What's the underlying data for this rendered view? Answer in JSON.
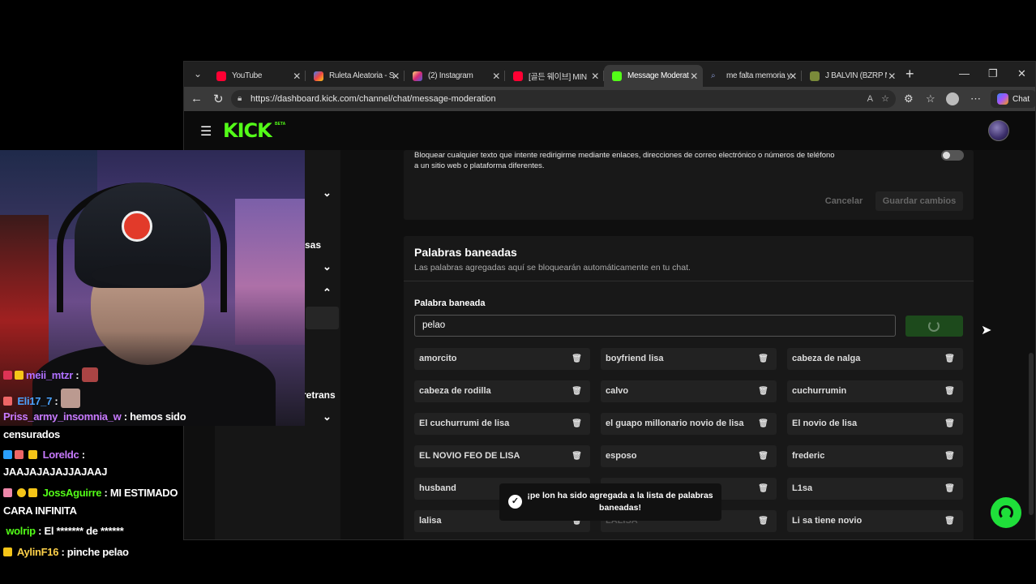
{
  "browser": {
    "tabs": [
      {
        "title": "YouTube",
        "color": "#ff0033"
      },
      {
        "title": "Ruleta Aleatoria - S",
        "color": "#3b82f6"
      },
      {
        "title": "(2) Instagram",
        "color": "#d62976"
      },
      {
        "title": "[골든 웨이브] MIN",
        "color": "#ff0033"
      },
      {
        "title": "Message Moderatio",
        "color": "#53fc18"
      },
      {
        "title": "me falta memoria y",
        "color": "#8a9bd6"
      },
      {
        "title": "J BALVIN (BZRP M.",
        "color": "#7a8a3a"
      }
    ],
    "url": "https://dashboard.kick.com/channel/chat/message-moderation",
    "chat_label": "Chat"
  },
  "kick": {
    "logo": "KICK",
    "beta": "BETA",
    "nav_fragments": [
      "sas",
      "retrans"
    ],
    "links_setting": {
      "description": "Bloquear cualquier texto que intente redirigirme mediante enlaces, direcciones de correo electrónico o números de teléfono a un sitio web o plataforma diferentes.",
      "cancel_label": "Cancelar",
      "save_label": "Guardar cambios"
    },
    "banned": {
      "title": "Palabras baneadas",
      "subtitle": "Las palabras agregadas aquí se bloquearán automáticamente en tu chat.",
      "input_label": "Palabra baneada",
      "input_value": "pelao",
      "words": [
        [
          "amorcito",
          "boyfriend lisa",
          "cabeza de nalga"
        ],
        [
          "cabeza de rodilla",
          "calvo",
          "cuchurrumin"
        ],
        [
          "El cuchurrumi de lisa",
          "el guapo millonario novio de lisa",
          "El novio de lisa"
        ],
        [
          "EL NOVIO FEO DE LISA",
          "esposo",
          "frederic"
        ],
        [
          "husband",
          "",
          "L1sa"
        ],
        [
          "lalisa",
          "LALISA",
          "Li sa tiene novio"
        ]
      ]
    },
    "toast": "¡pe lon ha sido agregada a la lista de palabras baneadas!"
  },
  "stream_chat": [
    {
      "user": "meii_mtzr",
      "color": "#b070ff",
      "text": ""
    },
    {
      "user": "Eli17_7",
      "color": "#4aa3ff",
      "text": ""
    },
    {
      "user": "Priss_army_insomnia_w",
      "color": "#c87aff",
      "text": ": hemos sido"
    },
    {
      "user": "",
      "color": "#ffffff",
      "text": "censurados"
    },
    {
      "user": "Loreldc",
      "color": "#c87aff",
      "text": ":"
    },
    {
      "user": "",
      "color": "#ffffff",
      "text": "JAAJAJAJAJJAJAAJ"
    },
    {
      "user": "JossAguirre",
      "color": "#53fc18",
      "text": ": MI ESTIMADO"
    },
    {
      "user": "",
      "color": "#ffffff",
      "text": "CARA INFINITA"
    },
    {
      "user": "wolrip",
      "color": "#53fc18",
      "text": ": El ******* de ******"
    },
    {
      "user": "AylinF16",
      "color": "#ffd24a",
      "text": ": pinche pelao"
    }
  ]
}
